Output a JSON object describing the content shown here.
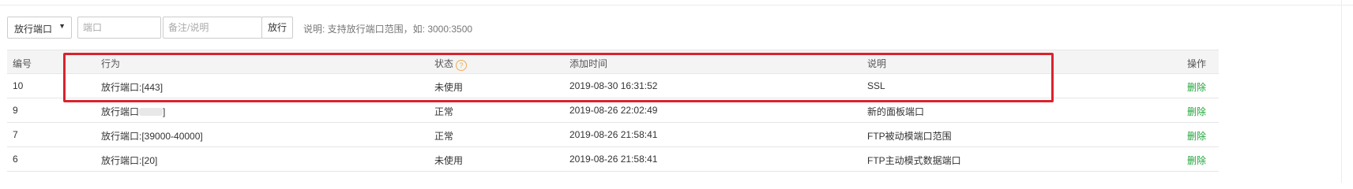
{
  "toolbar": {
    "action_select": "放行端口",
    "port_placeholder": "端口",
    "note_placeholder": "备注/说明",
    "submit_label": "放行",
    "hint": "说明: 支持放行端口范围，如: 3000:3500"
  },
  "table": {
    "headers": [
      "编号",
      "行为",
      "状态",
      "添加时间",
      "说明",
      "操作"
    ],
    "rows": [
      {
        "id": "10",
        "action": "放行端口:[443]",
        "status": "未使用",
        "time": "2019-08-30 16:31:52",
        "note": "SSL",
        "op": "删除"
      },
      {
        "id": "9",
        "action": "放行端口",
        "action_suffix": "]",
        "status": "正常",
        "time": "2019-08-26 22:02:49",
        "note": "新的面板端口",
        "op": "删除"
      },
      {
        "id": "7",
        "action": "放行端口:[39000-40000]",
        "status": "正常",
        "time": "2019-08-26 21:58:41",
        "note": "FTP被动模端口范围",
        "op": "删除"
      },
      {
        "id": "6",
        "action": "放行端口:[20]",
        "status": "未使用",
        "time": "2019-08-26 21:58:41",
        "note": "FTP主动模式数据端口",
        "op": "删除"
      }
    ]
  },
  "colors": {
    "accent_green": "#20a53a",
    "highlight_red": "#d9232d",
    "help_orange": "#f0ad4e"
  },
  "icons": {
    "status_help": "question-circle-icon",
    "select_caret": "triangle-down-icon"
  }
}
